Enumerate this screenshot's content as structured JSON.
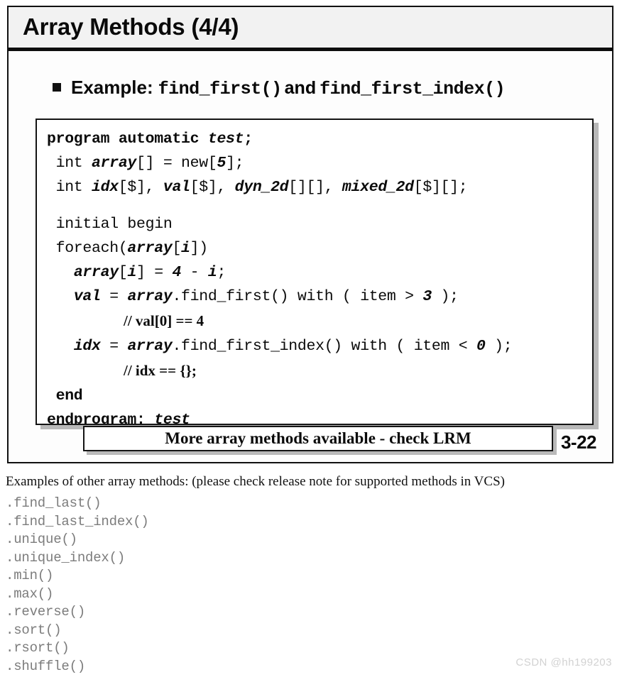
{
  "slide": {
    "title": "Array Methods (4/4)",
    "page_number": "3-22",
    "bullet": {
      "icon": "square-bullet",
      "label": "Example:",
      "method_one": "find_first()",
      "conjunction": "and",
      "method_two": "find_first_index()"
    },
    "code": {
      "language": "SystemVerilog",
      "lines": [
        {
          "id": "line-1",
          "text": "program automatic test;",
          "tokens": [
            {
              "t": "program automatic ",
              "s": "kw"
            },
            {
              "t": "test",
              "s": "id"
            },
            {
              "t": ";",
              "s": "kw"
            }
          ]
        },
        {
          "id": "line-2",
          "text": " int array[] = new[5];",
          "tokens": [
            {
              "t": " int ",
              "s": "plain"
            },
            {
              "t": "array",
              "s": "id"
            },
            {
              "t": "[] = new[",
              "s": "plain"
            },
            {
              "t": "5",
              "s": "num"
            },
            {
              "t": "];",
              "s": "plain"
            }
          ]
        },
        {
          "id": "line-3",
          "text": " int idx[$], val[$], dyn_2d[][], mixed_2d[$][];",
          "tokens": [
            {
              "t": " int ",
              "s": "plain"
            },
            {
              "t": "idx",
              "s": "id"
            },
            {
              "t": "[$], ",
              "s": "plain"
            },
            {
              "t": "val",
              "s": "id"
            },
            {
              "t": "[$], ",
              "s": "plain"
            },
            {
              "t": "dyn_2d",
              "s": "id"
            },
            {
              "t": "[][], ",
              "s": "plain"
            },
            {
              "t": "mixed_2d",
              "s": "id"
            },
            {
              "t": "[$][];",
              "s": "plain"
            }
          ]
        },
        {
          "id": "line-4",
          "text": "",
          "tokens": [],
          "blank": true
        },
        {
          "id": "line-5",
          "text": " initial begin",
          "tokens": [
            {
              "t": " initial begin",
              "s": "plain"
            }
          ]
        },
        {
          "id": "line-6",
          "text": " foreach(array[i])",
          "tokens": [
            {
              "t": " foreach(",
              "s": "plain"
            },
            {
              "t": "array",
              "s": "id"
            },
            {
              "t": "[",
              "s": "plain"
            },
            {
              "t": "i",
              "s": "id"
            },
            {
              "t": "])",
              "s": "plain"
            }
          ]
        },
        {
          "id": "line-7",
          "text": "   array[i] = 4 - i;",
          "tokens": [
            {
              "t": "   ",
              "s": "plain"
            },
            {
              "t": "array",
              "s": "id"
            },
            {
              "t": "[",
              "s": "plain"
            },
            {
              "t": "i",
              "s": "id"
            },
            {
              "t": "] = ",
              "s": "plain"
            },
            {
              "t": "4",
              "s": "num"
            },
            {
              "t": " - ",
              "s": "plain"
            },
            {
              "t": "i",
              "s": "id"
            },
            {
              "t": ";",
              "s": "plain"
            }
          ]
        },
        {
          "id": "line-8",
          "text": "   val = array.find_first() with ( item > 3 );",
          "tokens": [
            {
              "t": "   ",
              "s": "plain"
            },
            {
              "t": "val",
              "s": "id"
            },
            {
              "t": " = ",
              "s": "plain"
            },
            {
              "t": "array",
              "s": "id"
            },
            {
              "t": ".find_first() with ( item > ",
              "s": "plain"
            },
            {
              "t": "3",
              "s": "num"
            },
            {
              "t": " );",
              "s": "plain"
            }
          ]
        },
        {
          "id": "line-9",
          "text": "            // val[0] == 4",
          "comment": true,
          "indent": 108,
          "tokens": [
            {
              "t": "// val[0] == 4",
              "s": "cmt"
            }
          ]
        },
        {
          "id": "line-10",
          "text": "   idx = array.find_first_index() with ( item < 0 );",
          "tokens": [
            {
              "t": "   ",
              "s": "plain"
            },
            {
              "t": "idx",
              "s": "id"
            },
            {
              "t": " = ",
              "s": "plain"
            },
            {
              "t": "array",
              "s": "id"
            },
            {
              "t": ".find_first_index() with ( item < ",
              "s": "plain"
            },
            {
              "t": "0",
              "s": "num"
            },
            {
              "t": " );",
              "s": "plain"
            }
          ]
        },
        {
          "id": "line-11",
          "text": "            // idx == {};",
          "comment": true,
          "indent": 108,
          "tokens": [
            {
              "t": "// idx == {};",
              "s": "cmt"
            }
          ]
        },
        {
          "id": "line-12",
          "text": " end",
          "tokens": [
            {
              "t": " end",
              "s": "kw"
            }
          ]
        },
        {
          "id": "line-13",
          "text": "endprogram: test",
          "tokens": [
            {
              "t": "endprogram: ",
              "s": "kw"
            },
            {
              "t": "test",
              "s": "id"
            }
          ]
        }
      ]
    },
    "callout": "More array methods available - check LRM"
  },
  "notes": {
    "heading": "Examples of other array methods:  (please check release note for supported methods in VCS)",
    "methods": [
      ".find_last()",
      ".find_last_index()",
      ".unique()",
      ".unique_index()",
      ".min()",
      ".max()",
      ".reverse()",
      ".sort()",
      ".rsort()",
      ".shuffle()"
    ]
  },
  "watermark": "CSDN @hh199203",
  "colors": {
    "ink": "#0a0a0a",
    "title_band": "#f2f2f2",
    "shadow": "#b9b9b9",
    "method_text": "#7c7c7c",
    "watermark": "#d2d2d2"
  }
}
